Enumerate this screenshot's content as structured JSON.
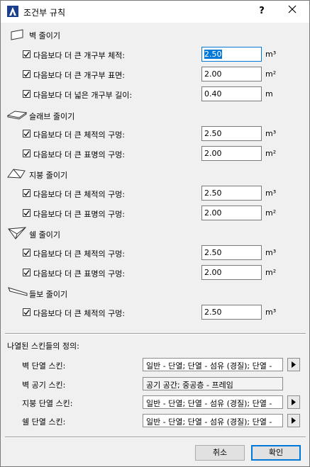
{
  "window": {
    "title": "조건부 규칙",
    "help_label": "?",
    "close_label": "✕"
  },
  "sections": [
    {
      "icon": "wall-icon",
      "label": "벽 줄이기",
      "rows": [
        {
          "checked": true,
          "label": "다음보다 더 큰 개구부 체적:",
          "value": "2.50",
          "unit": "m³",
          "focused": true
        },
        {
          "checked": true,
          "label": "다음보다 더 큰 개구부 표면:",
          "value": "2.00",
          "unit": "m²"
        },
        {
          "checked": true,
          "label": "다음보다 더 넓은 개구부 길이:",
          "value": "0.40",
          "unit": "m"
        }
      ]
    },
    {
      "icon": "slab-icon",
      "label": "슬래브 줄이기",
      "rows": [
        {
          "checked": true,
          "label": "다음보다 더 큰 체적의 구멍:",
          "value": "2.50",
          "unit": "m³"
        },
        {
          "checked": true,
          "label": "다음보다 더 큰 표명의 구멍:",
          "value": "2.00",
          "unit": "m²"
        }
      ]
    },
    {
      "icon": "roof-icon",
      "label": "지붕 줄이기",
      "rows": [
        {
          "checked": true,
          "label": "다음보다 더 큰 체적의 구멍:",
          "value": "2.50",
          "unit": "m³"
        },
        {
          "checked": true,
          "label": "다음보다 더 큰 표명의 구멍:",
          "value": "2.00",
          "unit": "m²"
        }
      ]
    },
    {
      "icon": "shell-icon",
      "label": "쉘 줄이기",
      "rows": [
        {
          "checked": true,
          "label": "다음보다 더 큰 체적의 구멍:",
          "value": "2.50",
          "unit": "m³"
        },
        {
          "checked": true,
          "label": "다음보다 더 큰 표명의 구멍:",
          "value": "2.00",
          "unit": "m²"
        }
      ]
    },
    {
      "icon": "beam-icon",
      "label": "들보 줄이기",
      "rows": [
        {
          "checked": true,
          "label": "다음보다 더 큰 체적의 구멍:",
          "value": "2.50",
          "unit": "m³"
        }
      ]
    }
  ],
  "skins": {
    "heading": "나열된 스킨들의 정의:",
    "items": [
      {
        "label": "벽 단열 스킨:",
        "value": "일반 - 단열; 단열 - 섬유 (경질); 단열 -",
        "has_arrow": true
      },
      {
        "label": "벽 공기 스킨:",
        "value": "공기 공간; 중공층 - 프레임",
        "has_arrow": false
      },
      {
        "label": "지붕 단열 스킨:",
        "value": "일반 - 단열; 단열 - 섬유 (경질); 단열 -",
        "has_arrow": true
      },
      {
        "label": "쉘 단열 스킨:",
        "value": "일반 - 단열; 단열 - 섬유 (경질); 단열 -",
        "has_arrow": true
      }
    ]
  },
  "buttons": {
    "cancel": "취소",
    "ok": "확인"
  },
  "colors": {
    "accent": "#0078d7",
    "background": "#f0f0f0"
  }
}
